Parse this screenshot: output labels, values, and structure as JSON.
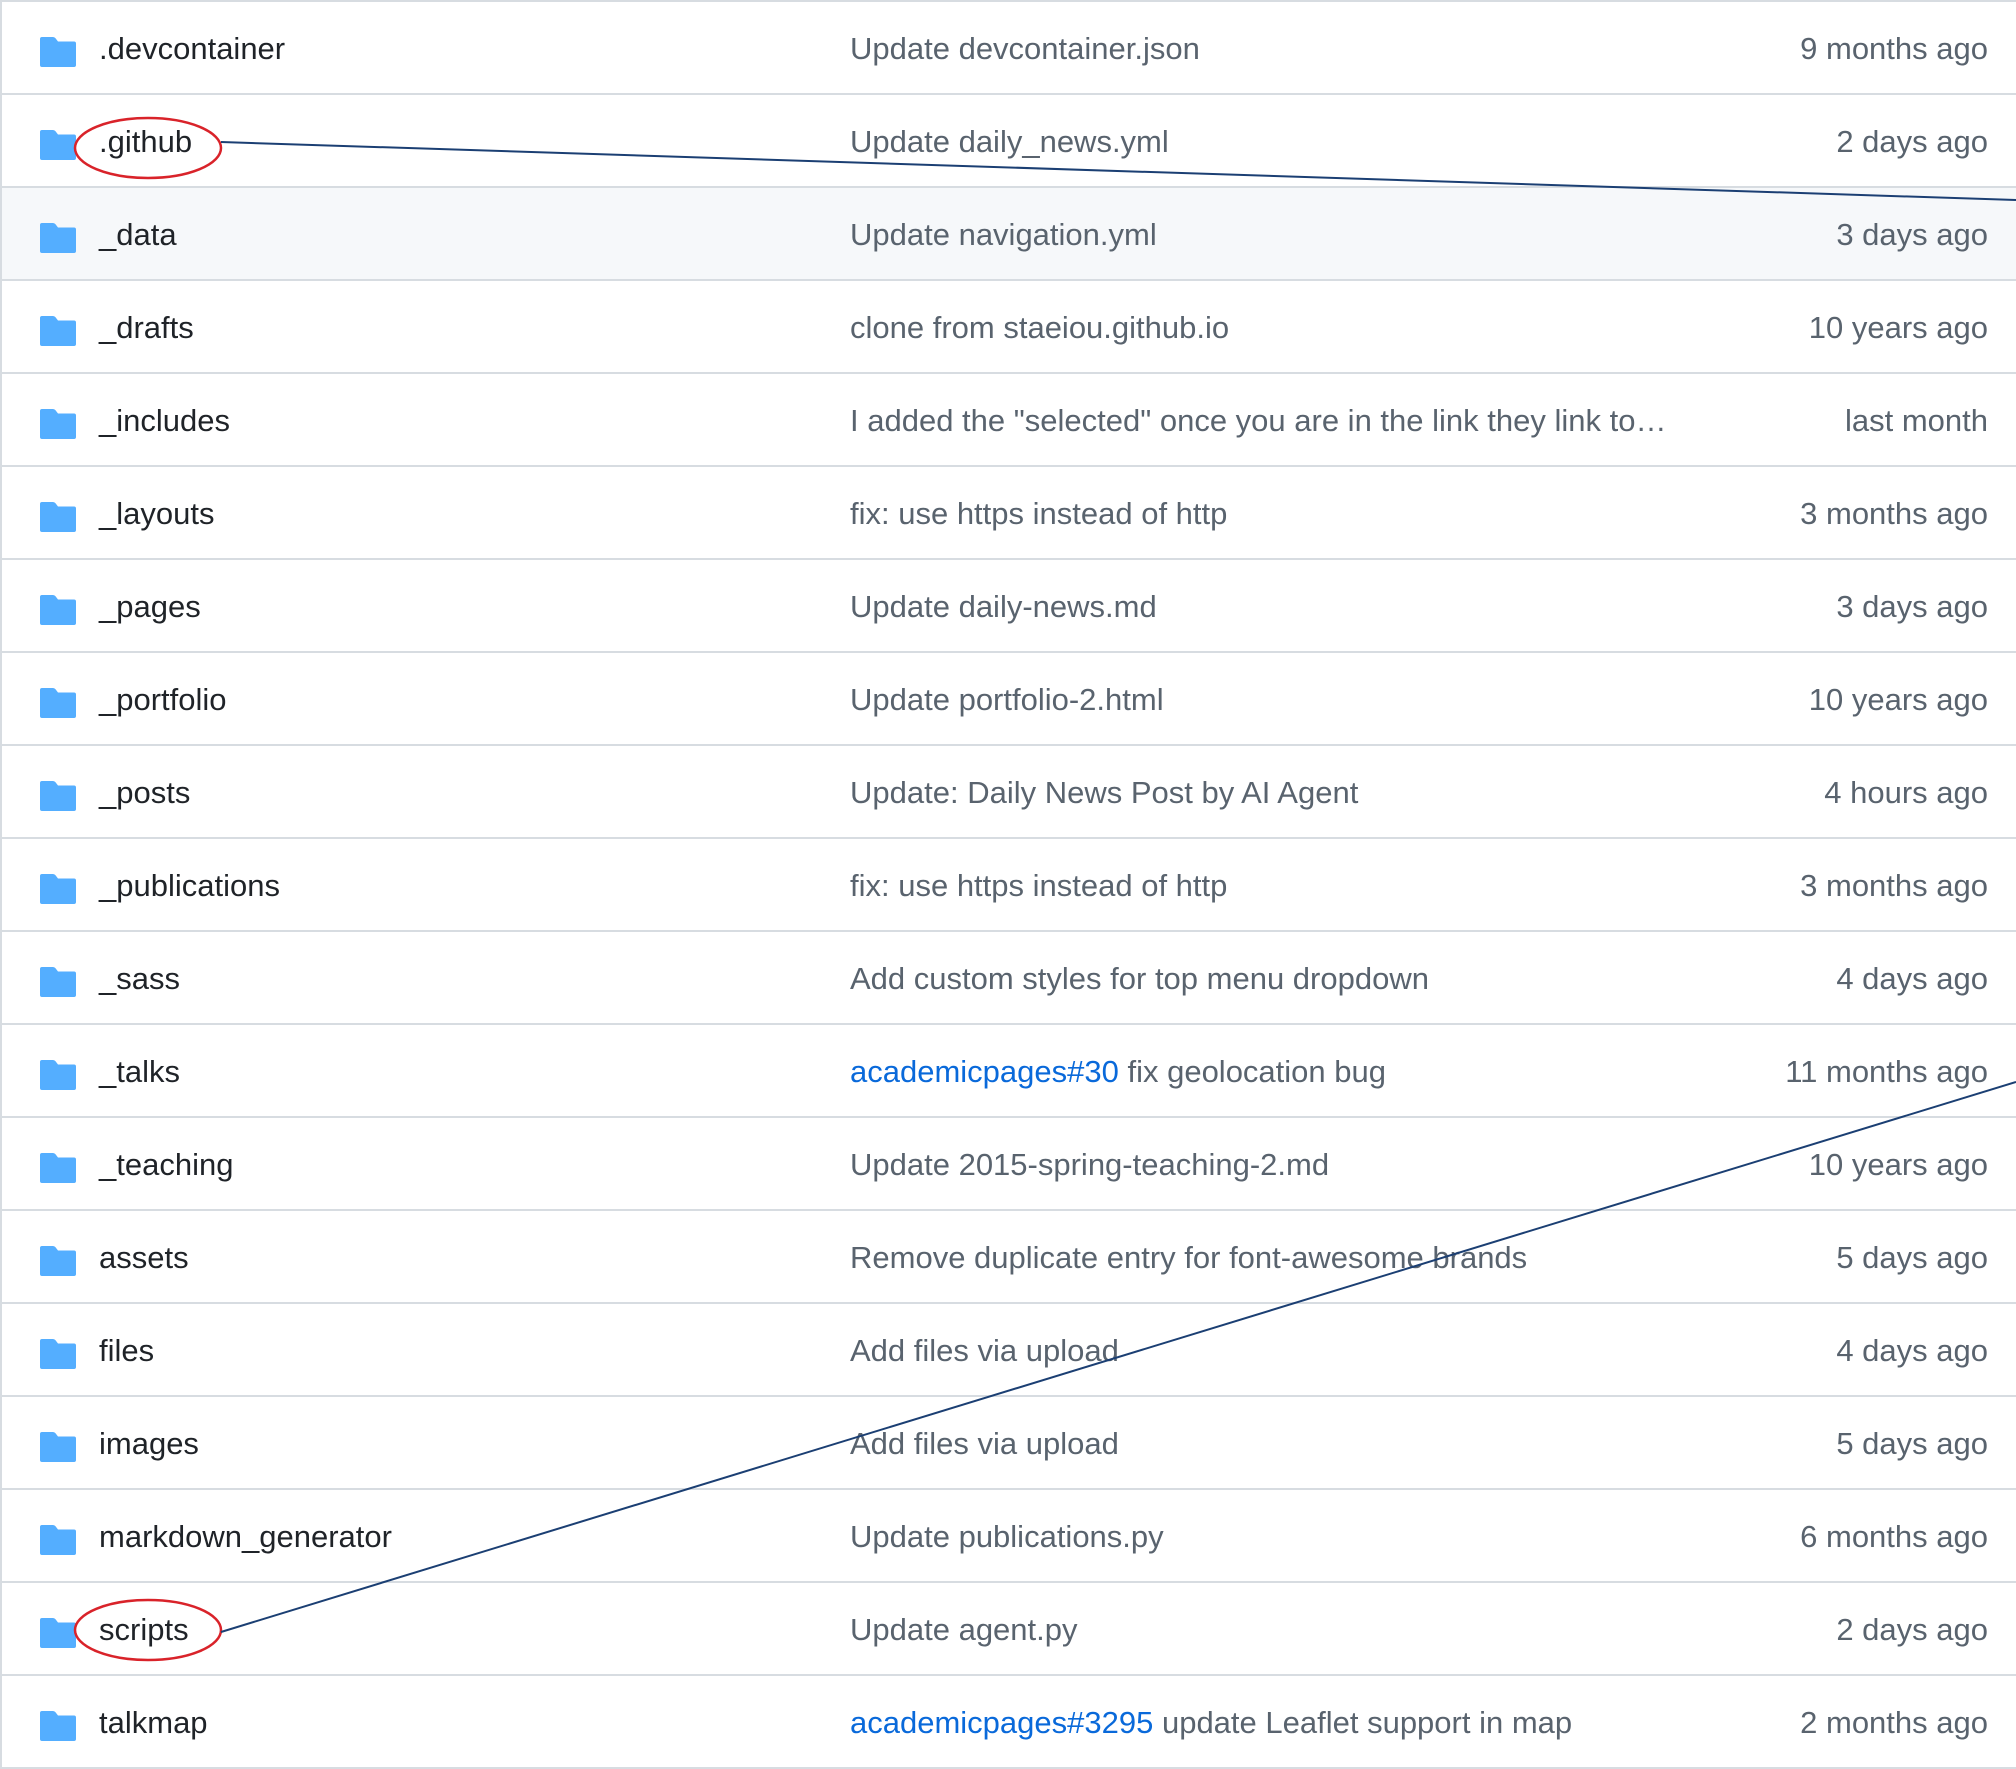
{
  "colors": {
    "folder": "#54aeff",
    "text_primary": "#1f2328",
    "text_muted": "#59636e",
    "link": "#0969da",
    "border": "#d7dce1",
    "row_highlight": "#f6f8fa",
    "annotation_circle": "#d9232a",
    "annotation_line": "#1b3f73"
  },
  "files": [
    {
      "name": ".devcontainer",
      "issue": "",
      "message": "Update devcontainer.json",
      "time": "9 months ago",
      "icon": "folder-icon"
    },
    {
      "name": ".github",
      "issue": "",
      "message": "Update daily_news.yml",
      "time": "2 days ago",
      "icon": "folder-icon"
    },
    {
      "name": "_data",
      "issue": "",
      "message": "Update navigation.yml",
      "time": "3 days ago",
      "icon": "folder-icon"
    },
    {
      "name": "_drafts",
      "issue": "",
      "message": "clone from staeiou.github.io",
      "time": "10 years ago",
      "icon": "folder-icon"
    },
    {
      "name": "_includes",
      "issue": "",
      "message": "I added the \"selected\" once you are in the link they link to…",
      "time": "last month",
      "icon": "folder-icon"
    },
    {
      "name": "_layouts",
      "issue": "",
      "message": "fix: use https instead of http",
      "time": "3 months ago",
      "icon": "folder-icon"
    },
    {
      "name": "_pages",
      "issue": "",
      "message": "Update daily-news.md",
      "time": "3 days ago",
      "icon": "folder-icon"
    },
    {
      "name": "_portfolio",
      "issue": "",
      "message": "Update portfolio-2.html",
      "time": "10 years ago",
      "icon": "folder-icon"
    },
    {
      "name": "_posts",
      "issue": "",
      "message": "Update: Daily News Post by AI Agent",
      "time": "4 hours ago",
      "icon": "folder-icon"
    },
    {
      "name": "_publications",
      "issue": "",
      "message": "fix: use https instead of http",
      "time": "3 months ago",
      "icon": "folder-icon"
    },
    {
      "name": "_sass",
      "issue": "",
      "message": "Add custom styles for top menu dropdown",
      "time": "4 days ago",
      "icon": "folder-icon"
    },
    {
      "name": "_talks",
      "issue": "academicpages#30",
      "message": " fix geolocation bug",
      "time": "11 months ago",
      "icon": "folder-icon"
    },
    {
      "name": "_teaching",
      "issue": "",
      "message": "Update 2015-spring-teaching-2.md",
      "time": "10 years ago",
      "icon": "folder-icon"
    },
    {
      "name": "assets",
      "issue": "",
      "message": "Remove duplicate entry for font-awesome brands",
      "time": "5 days ago",
      "icon": "folder-icon"
    },
    {
      "name": "files",
      "issue": "",
      "message": "Add files via upload",
      "time": "4 days ago",
      "icon": "folder-icon"
    },
    {
      "name": "images",
      "issue": "",
      "message": "Add files via upload",
      "time": "5 days ago",
      "icon": "folder-icon"
    },
    {
      "name": "markdown_generator",
      "issue": "",
      "message": "Update publications.py",
      "time": "6 months ago",
      "icon": "folder-icon"
    },
    {
      "name": "scripts",
      "issue": "",
      "message": "Update agent.py",
      "time": "2 days ago",
      "icon": "folder-icon"
    },
    {
      "name": "talkmap",
      "issue": "academicpages#3295",
      "message": " update Leaflet support in map",
      "time": "2 months ago",
      "icon": "folder-icon"
    }
  ]
}
